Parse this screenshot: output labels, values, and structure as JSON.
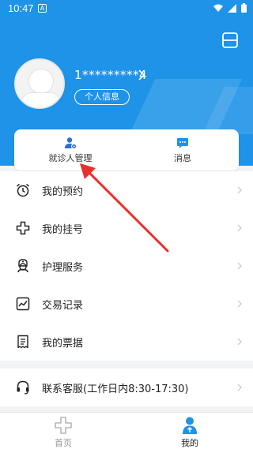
{
  "status_bar": {
    "time": "10:47",
    "notification_badge": "A"
  },
  "header": {
    "user_id": "1*********4",
    "profile_button": "个人信息"
  },
  "quick_actions": [
    {
      "label": "就诊人管理",
      "icon": "patient-manage-icon"
    },
    {
      "label": "消息",
      "icon": "message-icon"
    }
  ],
  "menu": [
    {
      "label": "我的预约",
      "icon": "alarm-clock-icon"
    },
    {
      "label": "我的挂号",
      "icon": "medical-cross-icon"
    },
    {
      "label": "护理服务",
      "icon": "nurse-icon"
    },
    {
      "label": "交易记录",
      "icon": "chart-icon"
    },
    {
      "label": "我的票据",
      "icon": "receipt-icon"
    }
  ],
  "service": {
    "label": "联系客服(工作日内8:30-17:30)",
    "icon": "headset-icon"
  },
  "tabbar": [
    {
      "label": "首页",
      "icon": "home-cross-icon",
      "active": false
    },
    {
      "label": "我的",
      "icon": "profile-icon",
      "active": true
    }
  ],
  "colors": {
    "brand": "#1e93e8",
    "annotation_arrow": "#e8302a"
  }
}
